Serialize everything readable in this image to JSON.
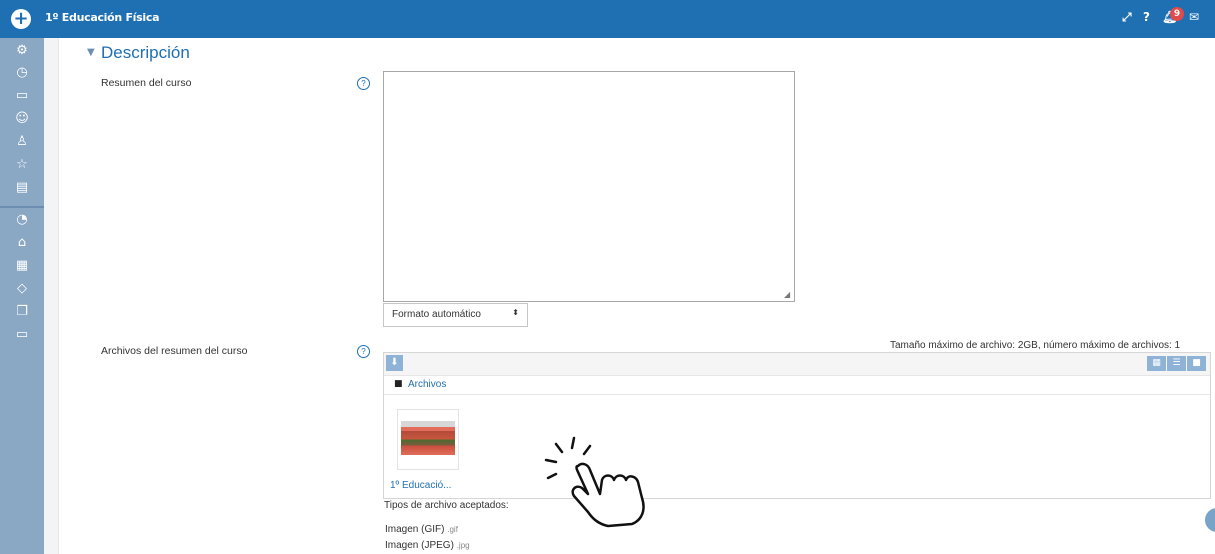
{
  "header": {
    "title": "1º Educación Física",
    "add_icon": "plus-circle-icon",
    "icons": [
      "expand-icon",
      "help-icon",
      "bell-icon",
      "envelope-icon"
    ],
    "notification_count": "9",
    "brand_color": "#1f6fb3"
  },
  "sidebar": {
    "icons": [
      "cogs-icon",
      "clock-icon",
      "folder-icon",
      "users-icon",
      "award-icon",
      "star-icon",
      "book-icon",
      "dashboard-icon",
      "home-icon",
      "calendar-icon",
      "graduation-cap-icon",
      "copy-icon",
      "folder-icon"
    ]
  },
  "section": {
    "title": "Descripción",
    "summary_label": "Resumen del curso",
    "format_value": "Formato automático",
    "files_label": "Archivos del resumen del curso",
    "limit_text": "Tamaño máximo de archivo: 2GB, número máximo de archivos: 1",
    "folder_path": "Archivos",
    "file_name": "1º Educació...",
    "accepted_title": "Tipos de archivo aceptados:",
    "accepted": [
      {
        "name": "Imagen (GIF)",
        "ext": ".gif"
      },
      {
        "name": "Imagen (JPEG)",
        "ext": ".jpg"
      }
    ]
  }
}
